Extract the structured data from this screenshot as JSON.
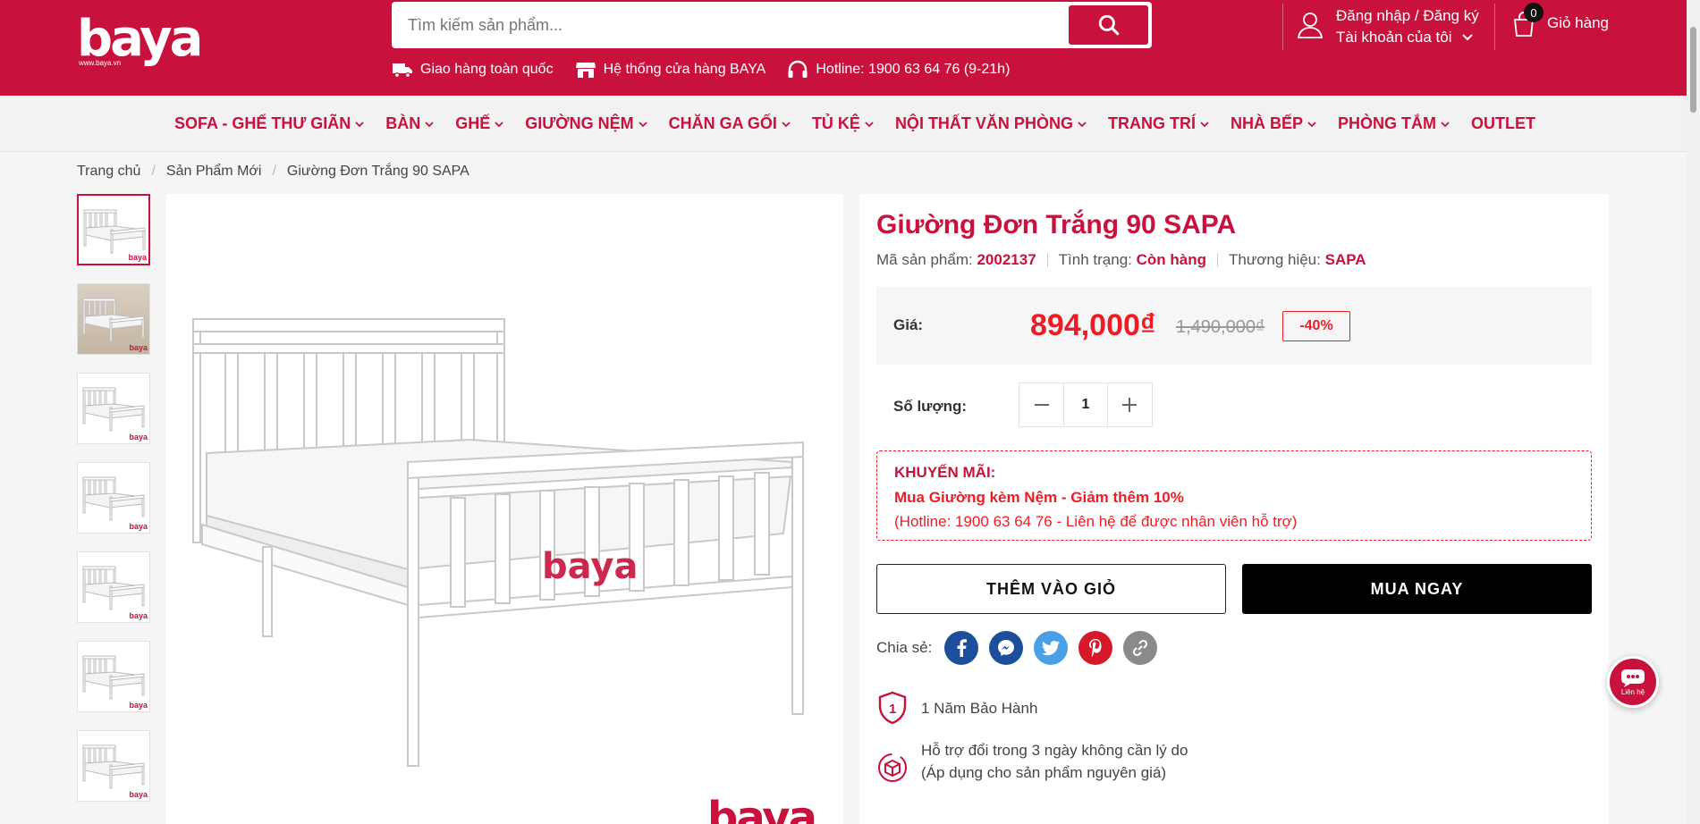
{
  "header": {
    "logo_text": "baya",
    "logo_sub": "www.baya.vn",
    "search_placeholder": "Tìm kiếm sản phẩm...",
    "subnav": [
      {
        "icon": "truck-icon",
        "label": "Giao hàng toàn quốc"
      },
      {
        "icon": "store-icon",
        "label": "Hệ thống cửa hàng BAYA"
      },
      {
        "icon": "headphones-icon",
        "label": "Hotline: 1900 63 64 76 (9-21h)"
      }
    ],
    "account": {
      "line1": "Đăng nhập / Đăng ký",
      "line2": "Tài khoản của tôi"
    },
    "cart": {
      "count": "0",
      "label": "Giỏ hàng"
    }
  },
  "nav": {
    "items": [
      {
        "label": "SOFA - GHẾ THƯ GIÃN",
        "dropdown": true
      },
      {
        "label": "BÀN",
        "dropdown": true
      },
      {
        "label": "GHẾ",
        "dropdown": true
      },
      {
        "label": "GIƯỜNG NỆM",
        "dropdown": true
      },
      {
        "label": "CHĂN GA GỐI",
        "dropdown": true
      },
      {
        "label": "TỦ KỆ",
        "dropdown": true
      },
      {
        "label": "NỘI THẤT VĂN PHÒNG",
        "dropdown": true
      },
      {
        "label": "TRANG TRÍ",
        "dropdown": true
      },
      {
        "label": "NHÀ BẾP",
        "dropdown": true
      },
      {
        "label": "PHÒNG TẮM",
        "dropdown": true
      },
      {
        "label": "OUTLET",
        "dropdown": false
      }
    ]
  },
  "breadcrumb": [
    "Trang chủ",
    "Sản Phẩm Mới",
    "Giường Đơn Trắng 90 SAPA"
  ],
  "gallery": {
    "thumb_count": 7,
    "image_logo": "baya",
    "thumb_logo": "baya"
  },
  "product": {
    "title": "Giường Đơn Trắng 90 SAPA",
    "sku_label": "Mã sản phẩm:",
    "sku": "2002137",
    "status_label": "Tình trạng:",
    "status": "Còn hàng",
    "brand_label": "Thương hiệu:",
    "brand": "SAPA",
    "price_label": "Giá:",
    "price": "894,000₫",
    "old_price": "1,490,000₫",
    "discount": "-40%",
    "qty_label": "Số lượng:",
    "qty": "1",
    "promo_title": "KHUYẾN MÃI:",
    "promo_line1": "Mua Giường kèm Nệm - Giảm thêm 10%",
    "promo_line2": "(Hotline: 1900 63 64 76 - Liên hệ để được nhân viên hỗ trợ)",
    "add_to_cart": "THÊM VÀO GIỎ",
    "buy_now": "MUA NGAY",
    "share_label": "Chia sẻ:",
    "share": [
      {
        "icon": "facebook-icon",
        "color": "#1d4e9b"
      },
      {
        "icon": "messenger-icon",
        "color": "#1d4e9b"
      },
      {
        "icon": "twitter-icon",
        "color": "#4aa0e6"
      },
      {
        "icon": "pinterest-icon",
        "color": "#d7182a"
      },
      {
        "icon": "link-icon",
        "color": "#8a8a8a"
      }
    ],
    "warranty": "1 Năm Bảo Hành",
    "return_policy": "Hỗ trợ đổi trong 3 ngày không cần lý do (Áp dụng cho sản phẩm nguyên giá)"
  },
  "chat": {
    "label": "Liên hệ"
  },
  "colors": {
    "brand": "#c8123d",
    "price": "#ee1c25",
    "nav_bg": "#f2f2f2"
  }
}
